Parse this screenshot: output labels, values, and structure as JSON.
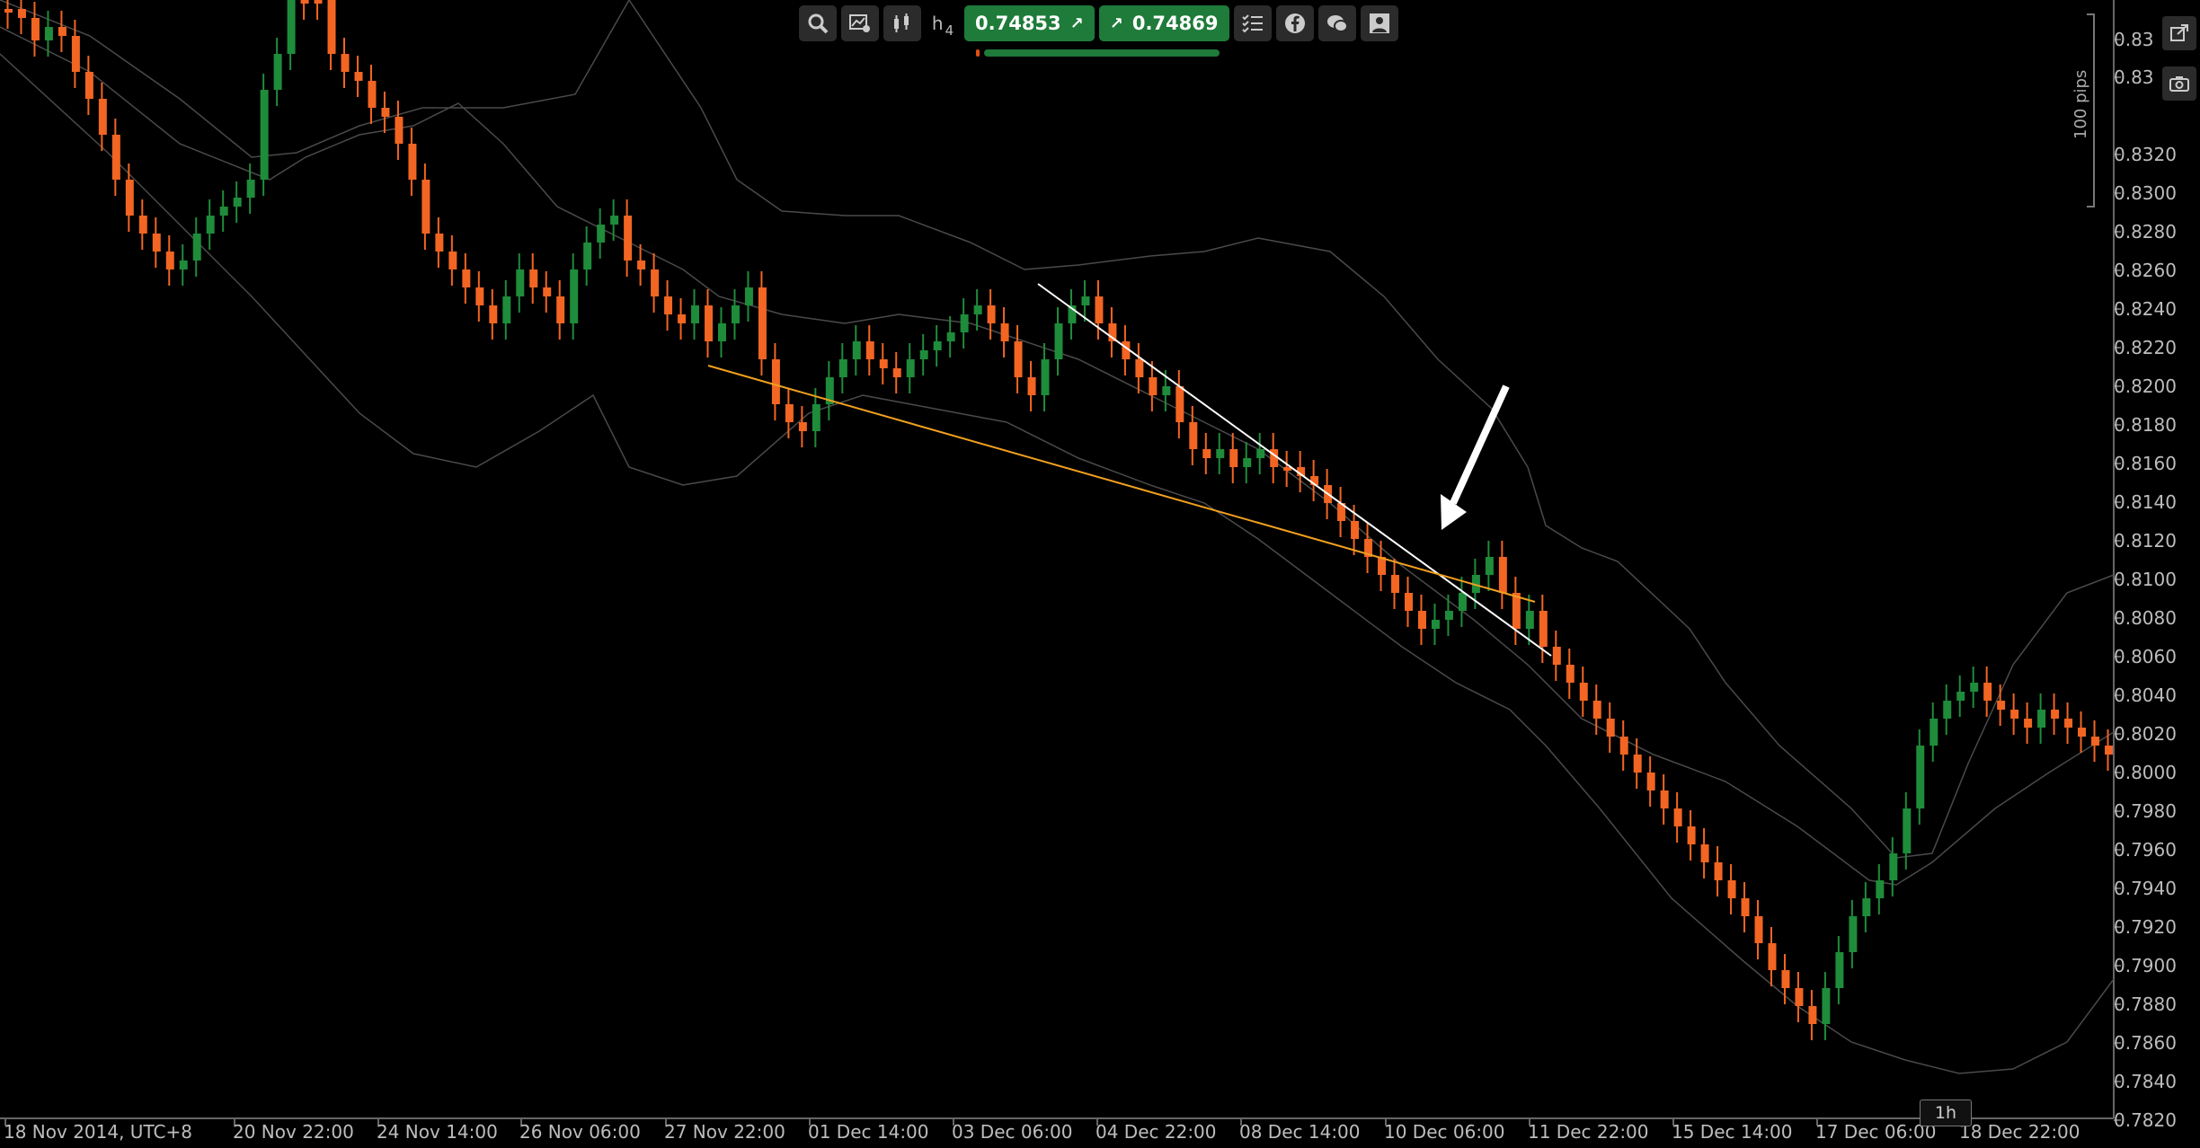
{
  "toolbar": {
    "period_letter": "h",
    "period_number": "4",
    "sell_price": "0.74853",
    "buy_price": "0.74869",
    "sell_icon": "arrow-up-right-icon",
    "buy_icon": "arrow-up-right-icon"
  },
  "axis": {
    "pips_label": "100 pips",
    "timeframe_badge": "1h",
    "y_ticks": [
      "0.83",
      "0.83",
      "0.8320",
      "0.8300",
      "0.8280",
      "0.8260",
      "0.8240",
      "0.8220",
      "0.8200",
      "0.8180",
      "0.8160",
      "0.8140",
      "0.8120",
      "0.8100",
      "0.8080",
      "0.8060",
      "0.8040",
      "0.8020",
      "0.8000",
      "0.7980",
      "0.7960",
      "0.7940",
      "0.7920",
      "0.7900",
      "0.7880",
      "0.7860",
      "0.7840",
      "0.7820"
    ],
    "x_ticks": [
      "18 Nov 2014, UTC+8",
      "20 Nov 22:00",
      "24 Nov 14:00",
      "26 Nov 06:00",
      "27 Nov 22:00",
      "01 Dec 14:00",
      "03 Dec 06:00",
      "04 Dec 22:00",
      "08 Dec 14:00",
      "10 Dec 06:00",
      "11 Dec 22:00",
      "15 Dec 14:00",
      "17 Dec 06:00",
      "18 Dec 22:00"
    ]
  },
  "colors": {
    "up": "#1e8c3a",
    "down": "#f26522",
    "background": "#000000",
    "band": "#4a4a4a",
    "trendline_white": "#ffffff",
    "trendline_orange": "#f0a020"
  }
}
